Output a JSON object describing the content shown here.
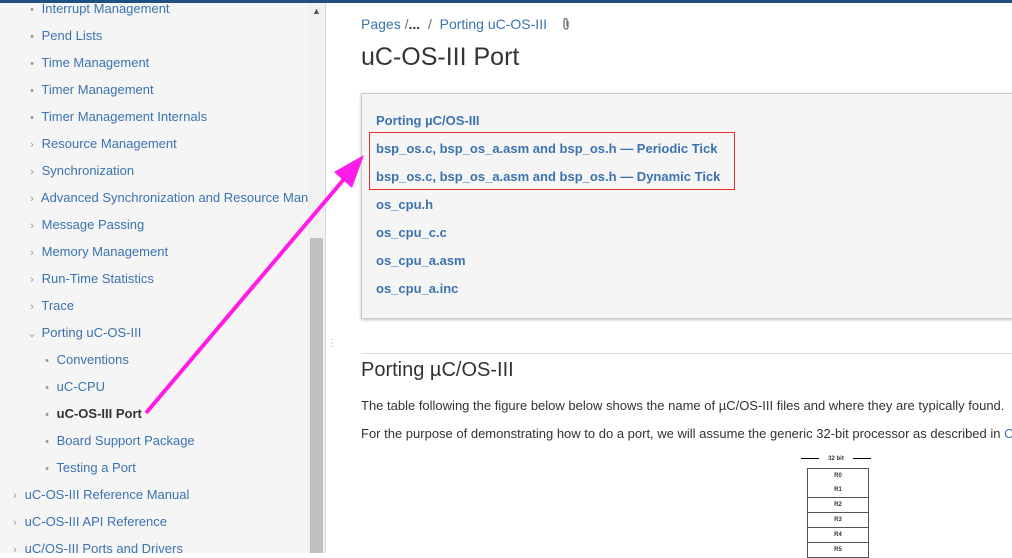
{
  "sidebar": {
    "items": [
      {
        "label": "Interrupt Management",
        "marker": "•"
      },
      {
        "label": "Pend Lists",
        "marker": "•"
      },
      {
        "label": "Time Management",
        "marker": "•"
      },
      {
        "label": "Timer Management",
        "marker": "•"
      },
      {
        "label": "Timer Management Internals",
        "marker": "•"
      },
      {
        "label": "Resource Management",
        "marker": "›"
      },
      {
        "label": "Synchronization",
        "marker": "›"
      },
      {
        "label": "Advanced Synchronization and Resource Manag",
        "marker": "›"
      },
      {
        "label": "Message Passing",
        "marker": "›"
      },
      {
        "label": "Memory Management",
        "marker": "›"
      },
      {
        "label": "Run-Time Statistics",
        "marker": "›"
      },
      {
        "label": "Trace",
        "marker": "›"
      },
      {
        "label": "Porting uC-OS-III",
        "marker": "⌄"
      },
      {
        "label": "Conventions",
        "marker": "•"
      },
      {
        "label": "uC-CPU",
        "marker": "•"
      },
      {
        "label": "uC-OS-III Port",
        "marker": "•"
      },
      {
        "label": "Board Support Package",
        "marker": "•"
      },
      {
        "label": "Testing a Port",
        "marker": "•"
      },
      {
        "label": "uC-OS-III Reference Manual",
        "marker": "›"
      },
      {
        "label": "uC-OS-III API Reference",
        "marker": "›"
      },
      {
        "label": "uC/OS-III Ports and Drivers",
        "marker": "›"
      }
    ]
  },
  "breadcrumb": {
    "pages": "Pages",
    "sep1": "/",
    "ellipsis": "...",
    "sep2": "/",
    "parent": "Porting uC-OS-III",
    "attachment_icon": "paperclip-icon"
  },
  "page": {
    "title": "uC-OS-III Port"
  },
  "toc": {
    "links": [
      "Porting µC/OS-III",
      "bsp_os.c, bsp_os_a.asm and bsp_os.h — Periodic Tick",
      "bsp_os.c, bsp_os_a.asm and bsp_os.h — Dynamic Tick",
      "os_cpu.h",
      "os_cpu_c.c",
      "os_cpu_a.asm",
      "os_cpu_a.inc"
    ]
  },
  "section": {
    "heading": "Porting µC/OS-III",
    "para1": "The table following the figure below below shows the name of µC/OS-III files and where they are typically found.",
    "para2": "For the purpose of demonstrating how to do a port, we will assume the generic 32-bit processor as described in ",
    "para2_link": "Co"
  },
  "diagram": {
    "width_label": "32 bit",
    "registers": [
      "R0",
      "R1",
      "R2",
      "R3",
      "R4",
      "R5"
    ]
  },
  "colors": {
    "link": "#3b73af",
    "highlight_box": "#e03030",
    "annotation_arrow": "#ff1ce8"
  }
}
